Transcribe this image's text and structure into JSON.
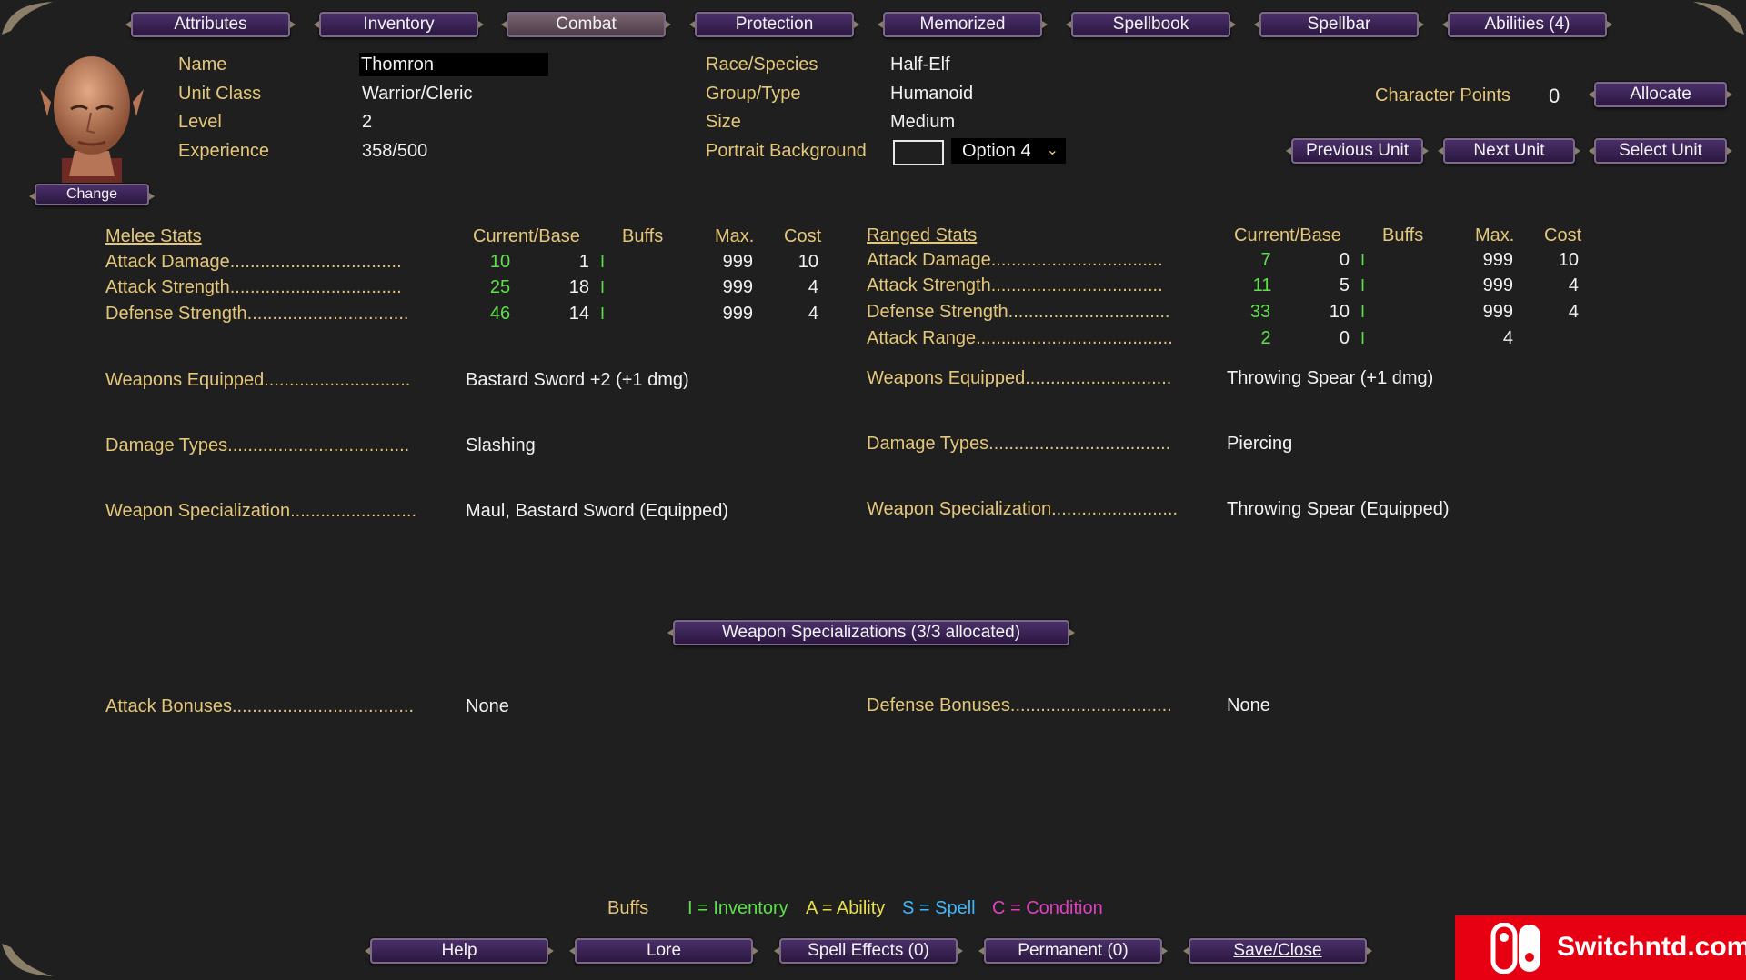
{
  "tabs": [
    "Attributes",
    "Inventory",
    "Combat",
    "Protection",
    "Memorized",
    "Spellbook",
    "Spellbar",
    "Abilities (4)"
  ],
  "active_tab": "Combat",
  "portrait": {
    "change_label": "Change"
  },
  "info": {
    "name_label": "Name",
    "name_value": "Thomron",
    "class_label": "Unit Class",
    "class_value": "Warrior/Cleric",
    "level_label": "Level",
    "level_value": "2",
    "exp_label": "Experience",
    "exp_value": "358/500",
    "race_label": "Race/Species",
    "race_value": "Half-Elf",
    "group_label": "Group/Type",
    "group_value": "Humanoid",
    "size_label": "Size",
    "size_value": "Medium",
    "bg_label": "Portrait Background",
    "bg_value": "Option 4",
    "cp_label": "Character Points",
    "cp_value": "0"
  },
  "buttons": {
    "allocate": "Allocate",
    "previous": "Previous Unit",
    "next": "Next Unit",
    "select": "Select Unit",
    "weapon_spec": "Weapon Specializations (3/3 allocated)"
  },
  "melee": {
    "title": "Melee Stats",
    "cols": [
      "Current/Base",
      "Buffs",
      "Max.",
      "Cost"
    ],
    "rows": [
      {
        "label": "Attack Damage..................................",
        "current": "10",
        "base": "1",
        "buff": "I",
        "max": "999",
        "cost": "10"
      },
      {
        "label": "Attack Strength..................................",
        "current": "25",
        "base": "18",
        "buff": "I",
        "max": "999",
        "cost": "4"
      },
      {
        "label": "Defense Strength................................",
        "current": "46",
        "base": "14",
        "buff": "I",
        "max": "999",
        "cost": "4"
      }
    ],
    "weapons_label": "Weapons Equipped.............................",
    "weapons_value": "Bastard Sword +2 (+1 dmg)",
    "dmg_label": "Damage Types....................................",
    "dmg_value": "Slashing",
    "spec_label": "Weapon Specialization.........................",
    "spec_value": "Maul, Bastard Sword (Equipped)",
    "bonus_label": "Attack Bonuses....................................",
    "bonus_value": "None"
  },
  "ranged": {
    "title": "Ranged Stats",
    "cols": [
      "Current/Base",
      "Buffs",
      "Max.",
      "Cost"
    ],
    "rows": [
      {
        "label": "Attack Damage..................................",
        "current": "7",
        "base": "0",
        "buff": "I",
        "max": "999",
        "cost": "10"
      },
      {
        "label": "Attack Strength..................................",
        "current": "11",
        "base": "5",
        "buff": "I",
        "max": "999",
        "cost": "4"
      },
      {
        "label": "Defense Strength................................",
        "current": "33",
        "base": "10",
        "buff": "I",
        "max": "999",
        "cost": "4"
      },
      {
        "label": "Attack Range.......................................",
        "current": "2",
        "base": "0",
        "buff": "I",
        "max": "4",
        "cost": ""
      }
    ],
    "weapons_label": "Weapons Equipped.............................",
    "weapons_value": "Throwing Spear (+1 dmg)",
    "dmg_label": "Damage Types....................................",
    "dmg_value": "Piercing",
    "spec_label": "Weapon Specialization.........................",
    "spec_value": "Throwing Spear (Equipped)",
    "bonus_label": "Defense Bonuses................................",
    "bonus_value": "None"
  },
  "legend": {
    "title": "Buffs",
    "items": [
      {
        "text": "I = Inventory",
        "color": "#5de04a"
      },
      {
        "text": "A = Ability",
        "color": "#e8e04a"
      },
      {
        "text": "S = Spell",
        "color": "#3fb8ff"
      },
      {
        "text": "C = Condition",
        "color": "#e040c0"
      }
    ]
  },
  "footer": [
    "Help",
    "Lore",
    "Spell Effects (0)",
    "Permanent (0)",
    "Save/Close"
  ],
  "watermark": {
    "text": "Switchntd.com",
    "color": "#e60012"
  }
}
